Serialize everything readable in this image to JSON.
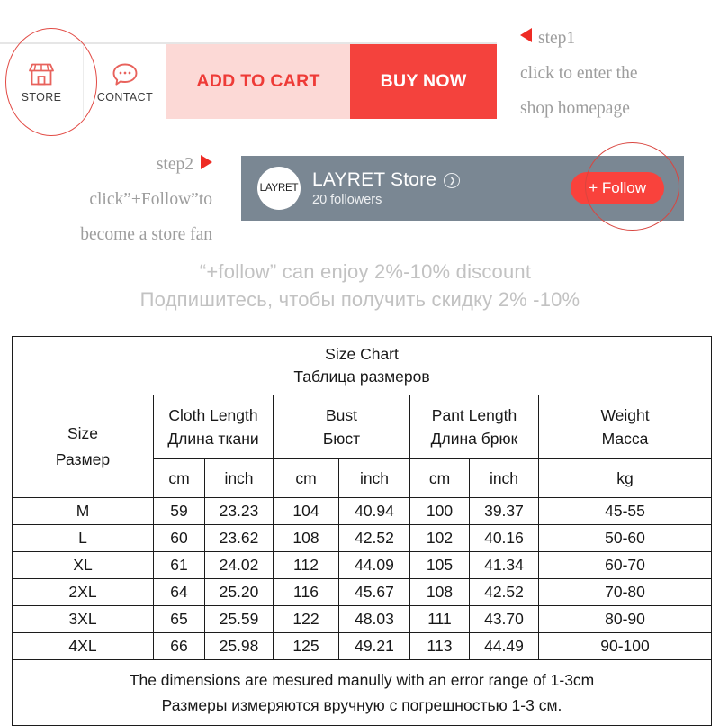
{
  "action_bar": {
    "store": {
      "label": "STORE",
      "icon": "store-icon"
    },
    "contact": {
      "label": "CONTACT",
      "icon": "chat-bubble-icon"
    },
    "add_to_cart": "ADD TO CART",
    "buy_now": "BUY NOW",
    "colors": {
      "add_to_cart_bg": "#fcd9d6",
      "add_to_cart_text": "#ee3b37",
      "buy_now_bg": "#f4423d",
      "buy_now_text": "#ffffff",
      "highlight_circle": "#e24b45"
    }
  },
  "annotations": {
    "step1": {
      "label": "step1",
      "line2": "click to enter the",
      "line3": "shop homepage"
    },
    "step2": {
      "label": "step2",
      "line2": "click”+Follow”to",
      "line3": "become a store fan"
    },
    "arrow_color": "#ee2b24",
    "text_color": "#9d9d9d"
  },
  "store_banner": {
    "avatar_text": "LAYRET",
    "store_name": "LAYRET  Store",
    "arrow_icon": "chevron-right-circle-icon",
    "followers": "20 followers",
    "follow_button": "+ Follow",
    "banner_bg": "#7a8793",
    "follow_bg": "#f9423c"
  },
  "discount": {
    "english": "“+follow”   can enjoy 2%-10% discount",
    "russian": "Подпишитесь, чтобы получить скидку 2% -10%",
    "color": "#c2c2c2"
  },
  "size_chart": {
    "title_en": "Size Chart",
    "title_ru": "Таблица размеров",
    "size_header_en": "Size",
    "size_header_ru": "Размер",
    "groups": [
      {
        "en": "Cloth Length",
        "ru": "Длина ткани"
      },
      {
        "en": "Bust",
        "ru": "Бюст"
      },
      {
        "en": "Pant Length",
        "ru": "Длина брюк"
      },
      {
        "en": "Weight",
        "ru": "Масса"
      }
    ],
    "units": [
      "cm",
      "inch",
      "cm",
      "inch",
      "cm",
      "inch",
      "kg"
    ],
    "rows": [
      {
        "size": "M",
        "cloth_cm": "59",
        "cloth_in": "23.23",
        "bust_cm": "104",
        "bust_in": "40.94",
        "pant_cm": "100",
        "pant_in": "39.37",
        "weight": "45-55"
      },
      {
        "size": "L",
        "cloth_cm": "60",
        "cloth_in": "23.62",
        "bust_cm": "108",
        "bust_in": "42.52",
        "pant_cm": "102",
        "pant_in": "40.16",
        "weight": "50-60"
      },
      {
        "size": "XL",
        "cloth_cm": "61",
        "cloth_in": "24.02",
        "bust_cm": "112",
        "bust_in": "44.09",
        "pant_cm": "105",
        "pant_in": "41.34",
        "weight": "60-70"
      },
      {
        "size": "2XL",
        "cloth_cm": "64",
        "cloth_in": "25.20",
        "bust_cm": "116",
        "bust_in": "45.67",
        "pant_cm": "108",
        "pant_in": "42.52",
        "weight": "70-80"
      },
      {
        "size": "3XL",
        "cloth_cm": "65",
        "cloth_in": "25.59",
        "bust_cm": "122",
        "bust_in": "48.03",
        "pant_cm": "111",
        "pant_in": "43.70",
        "weight": "80-90"
      },
      {
        "size": "4XL",
        "cloth_cm": "66",
        "cloth_in": "25.98",
        "bust_cm": "125",
        "bust_in": "49.21",
        "pant_cm": "113",
        "pant_in": "44.49",
        "weight": "90-100"
      }
    ],
    "footer_en": "The dimensions are mesured manully with an error range of 1-3cm",
    "footer_ru": "Размеры измеряются вручную с погрешностью 1-3 см."
  }
}
